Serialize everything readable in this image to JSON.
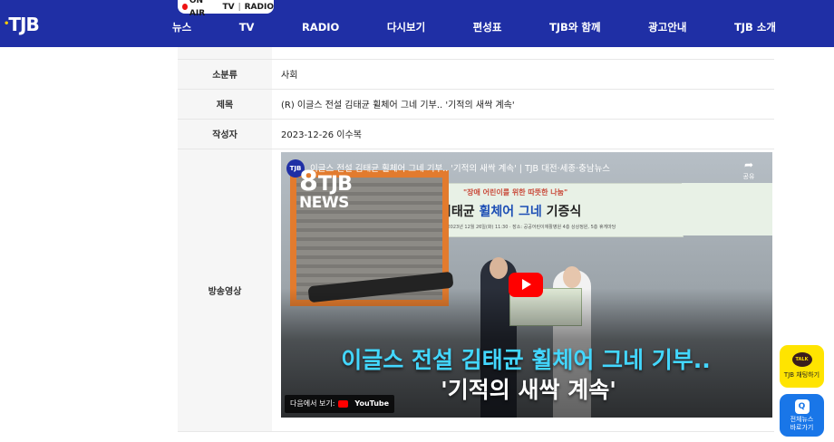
{
  "header": {
    "logo": "TJB",
    "onair": {
      "onair_label": "ON AIR",
      "tv_label": "TV",
      "radio_label": "RADIO"
    },
    "nav": [
      {
        "label": "뉴스"
      },
      {
        "label": "TV"
      },
      {
        "label": "RADIO"
      },
      {
        "label": "다시보기"
      },
      {
        "label": "편성표"
      },
      {
        "label": "TJB와 함께"
      },
      {
        "label": "광고안내"
      },
      {
        "label": "TJB 소개"
      }
    ]
  },
  "article": {
    "rows": [
      {
        "label": "소분류",
        "value": "사회"
      },
      {
        "label": "제목",
        "value": "(R) 이글스 전설 김태균 휠체어 그네 기부.. '기적의 새싹 계속'"
      },
      {
        "label": "작성자",
        "value": "2023-12-26 이수복"
      },
      {
        "label": "방송영상",
        "value": ""
      }
    ]
  },
  "video": {
    "channel_logo": "TJB",
    "title": "이글스 전설 김태균 휠체어 그네 기부.. '기적의 새싹 계속' | TJB 대전·세종·충남뉴스",
    "share_label": "공유",
    "news_logo_number": "8",
    "news_logo_brand": "TJB",
    "news_logo_word": "NEWS",
    "banner_sub": "\"장애 어린이를 위한 따뜻한 나눔\"",
    "banner_main_prefix": "김태균 ",
    "banner_main_highlight": "휠체어 그네",
    "banner_main_suffix": " 기증식",
    "banner_info": "일시: 2023년 12월 26일(화) 11:30 · 장소: 공공어린이재활병원 4층 상상정원, 5층 휴게마당",
    "caption_line1": "이글스 전설 김태균 휠체어 그네 기부..",
    "caption_line2": "'기적의 새싹 계속'",
    "watch_on_label": "다음에서 보기:",
    "youtube_label": "YouTube"
  },
  "floating": {
    "talk_icon": "TALK",
    "talk_label": "TJB 채팅하기",
    "news_icon": "Q",
    "news_label": "전체뉴스\n바로가기"
  }
}
